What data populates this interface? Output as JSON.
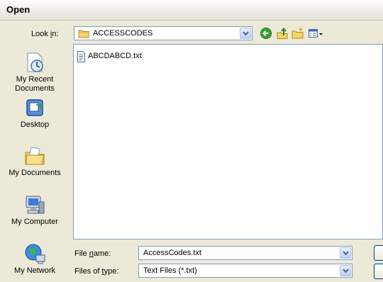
{
  "window": {
    "title": "Open"
  },
  "look_in": {
    "label_pre": "Look ",
    "label_key": "i",
    "label_post": "n:",
    "value": "ACCESSCODES"
  },
  "toolbar": {
    "icons": [
      "back-icon",
      "up-folder-icon",
      "new-folder-icon",
      "views-menu-icon"
    ]
  },
  "places": [
    {
      "name": "recent",
      "label_line1": "My Recent",
      "label_line2": "Documents",
      "icon": "recent-documents-icon"
    },
    {
      "name": "desktop",
      "label_line1": "Desktop",
      "label_line2": "",
      "icon": "desktop-icon"
    },
    {
      "name": "documents",
      "label_line1": "My Documents",
      "label_line2": "",
      "icon": "my-documents-icon"
    },
    {
      "name": "computer",
      "label_line1": "My Computer",
      "label_line2": "",
      "icon": "my-computer-icon"
    },
    {
      "name": "network",
      "label_line1": "My Network",
      "label_line2": "",
      "icon": "my-network-icon"
    }
  ],
  "files": [
    {
      "name": "ABCDABCD.txt",
      "icon": "text-file-icon"
    }
  ],
  "file_name": {
    "label_pre": "File ",
    "label_key": "n",
    "label_post": "ame:",
    "value": "AccessCodes.txt"
  },
  "file_type": {
    "label_pre": "Files of ",
    "label_key": "t",
    "label_post": "ype:",
    "value": "Text Files (*.txt)"
  },
  "colors": {
    "window_bg": "#ece9d8",
    "field_border": "#7f9db9",
    "accent_blue": "#3a6ea5"
  }
}
